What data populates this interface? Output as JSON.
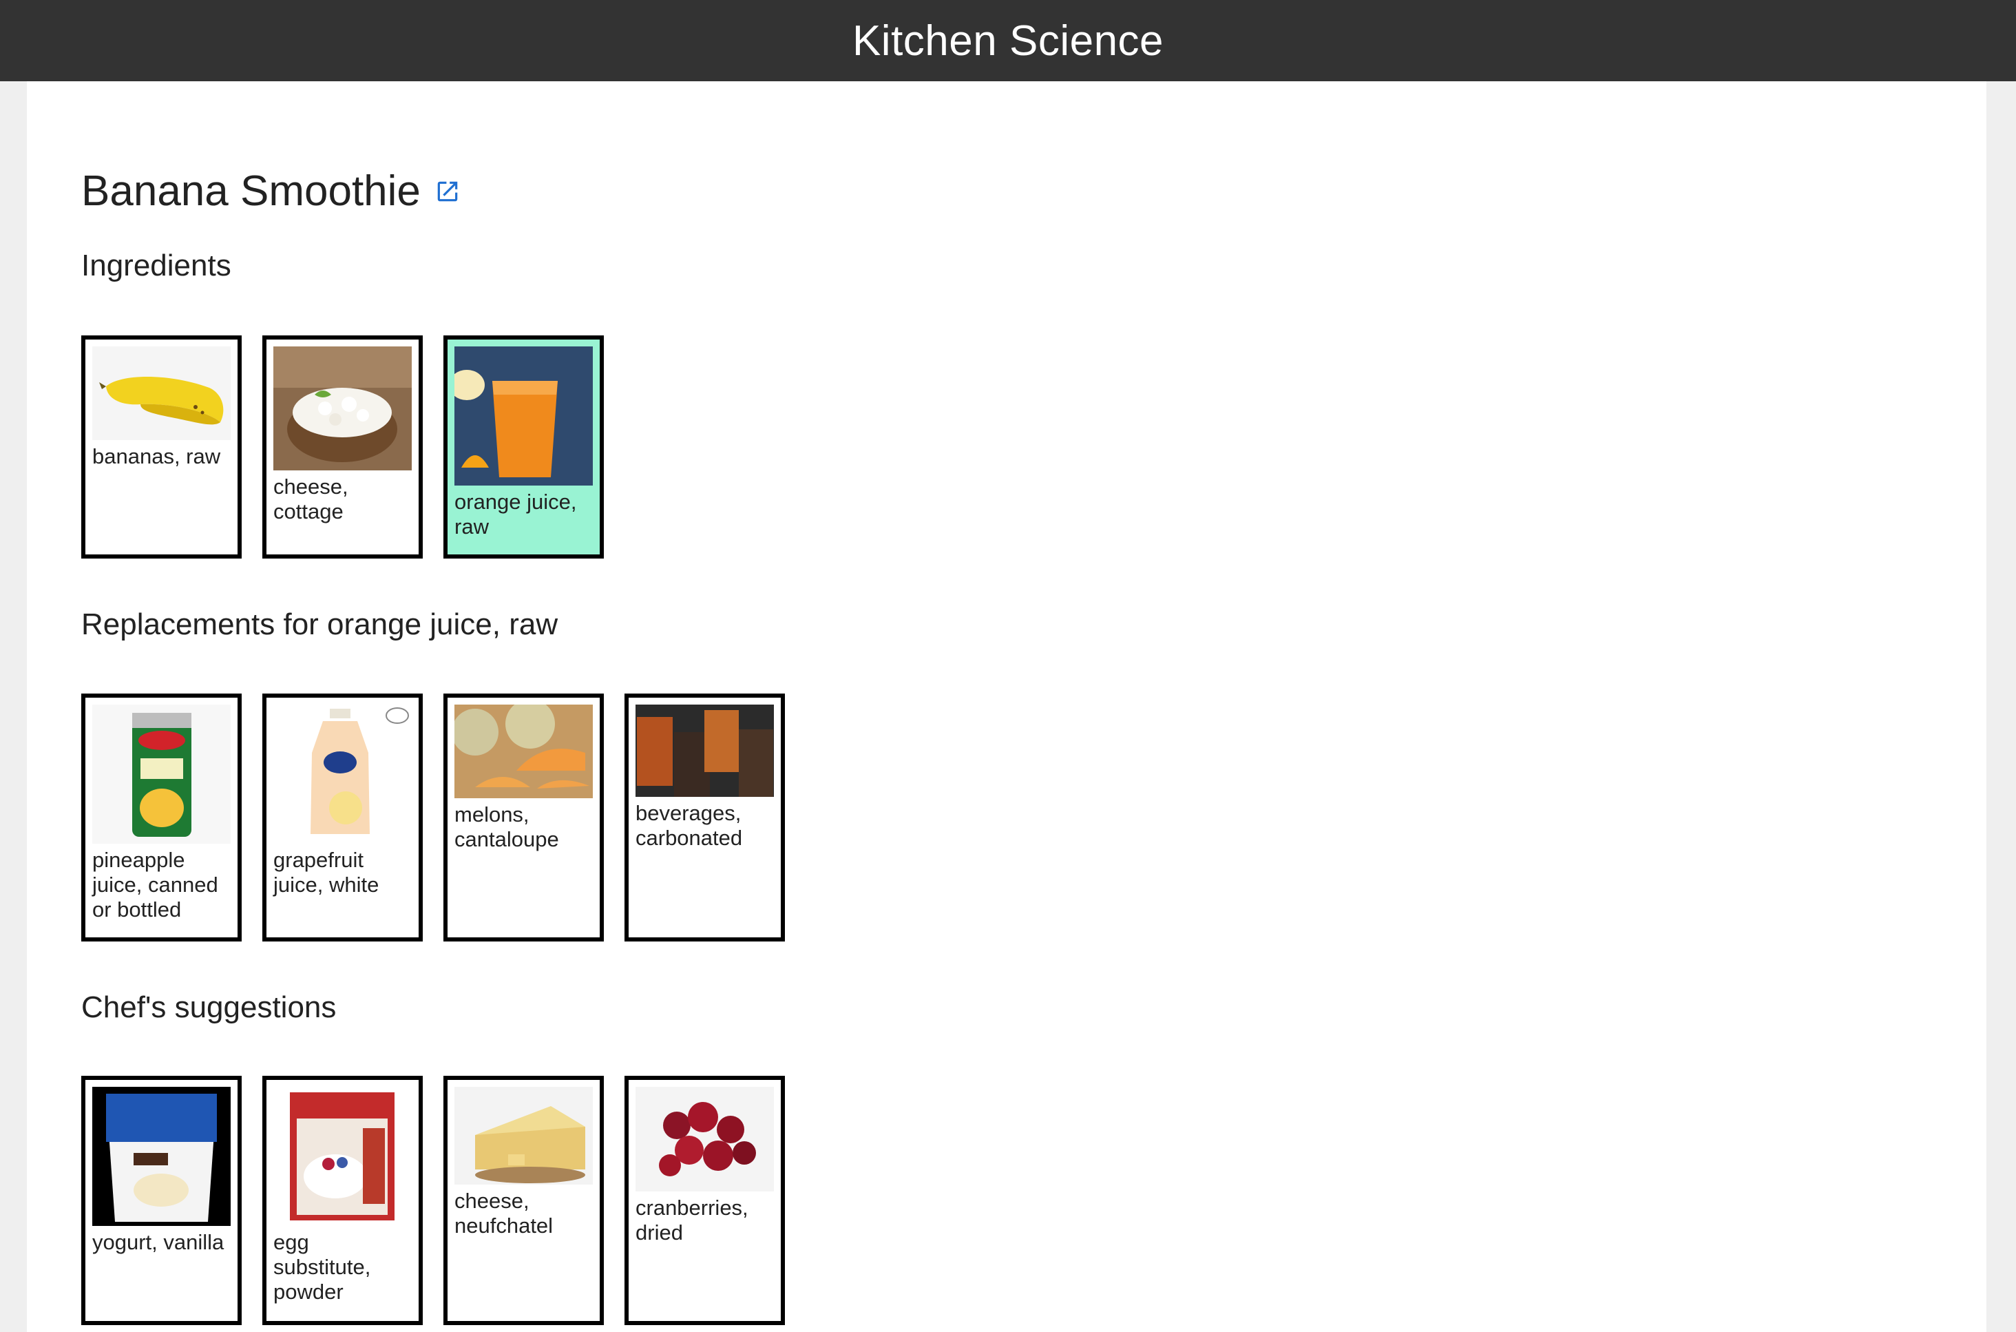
{
  "app": {
    "title": "Kitchen Science"
  },
  "recipe": {
    "title": "Banana Smoothie",
    "link_icon": "external-link-icon"
  },
  "sections": {
    "ingredients": {
      "title": "Ingredients",
      "items": [
        {
          "label": "bananas, raw",
          "image": "banana",
          "selected": false
        },
        {
          "label": "cheese, cottage",
          "image": "cottage-cheese",
          "selected": false
        },
        {
          "label": "orange juice, raw",
          "image": "orange-juice",
          "selected": true
        }
      ]
    },
    "replacements": {
      "title": "Replacements for orange juice, raw",
      "items": [
        {
          "label": "pineapple juice, canned or bottled",
          "image": "pineapple-juice-can"
        },
        {
          "label": "grapefruit juice, white",
          "image": "grapefruit-juice-bottle"
        },
        {
          "label": "melons, cantaloupe",
          "image": "cantaloupe"
        },
        {
          "label": "beverages, carbonated",
          "image": "carbonated-drinks"
        }
      ]
    },
    "suggestions": {
      "title": "Chef's suggestions",
      "items": [
        {
          "label": "yogurt, vanilla",
          "image": "vanilla-yogurt-cup"
        },
        {
          "label": "egg substitute, powder",
          "image": "egg-substitute-box"
        },
        {
          "label": "cheese, neufchatel",
          "image": "neufchatel-cheese"
        },
        {
          "label": "cranberries, dried",
          "image": "cranberries"
        }
      ]
    }
  },
  "colors": {
    "topbar": "#333333",
    "selected_card": "#99f3d3",
    "link_icon": "#1f6fd1"
  }
}
